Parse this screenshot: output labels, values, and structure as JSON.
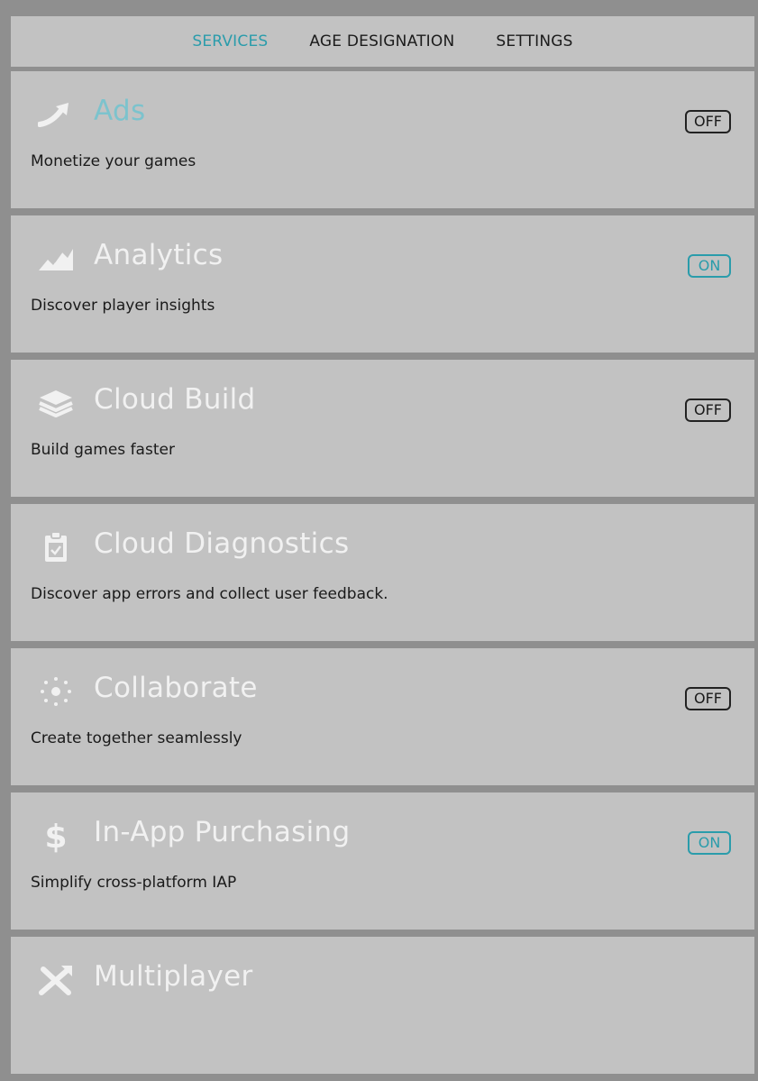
{
  "tabs": {
    "services": "SERVICES",
    "age_designation": "AGE DESIGNATION",
    "settings": "SETTINGS"
  },
  "colors": {
    "accent": "#2a9cab",
    "title_inactive": "#f1f1f1",
    "card_bg": "#c2c2c2"
  },
  "services": [
    {
      "icon": "trending-arrow-icon",
      "title": "Ads",
      "description": "Monetize your games",
      "toggle": "OFF"
    },
    {
      "icon": "chart-area-icon",
      "title": "Analytics",
      "description": "Discover player insights",
      "toggle": "ON"
    },
    {
      "icon": "layers-icon",
      "title": "Cloud Build",
      "description": "Build games faster",
      "toggle": "OFF"
    },
    {
      "icon": "clipboard-check-icon",
      "title": "Cloud Diagnostics",
      "description": "Discover app errors and collect user feedback.",
      "toggle": ""
    },
    {
      "icon": "network-nodes-icon",
      "title": "Collaborate",
      "description": "Create together seamlessly",
      "toggle": "OFF"
    },
    {
      "icon": "dollar-icon",
      "title": "In-App Purchasing",
      "description": "Simplify cross-platform IAP",
      "toggle": "ON"
    },
    {
      "icon": "crossed-arrows-icon",
      "title": "Multiplayer",
      "description": "",
      "toggle": ""
    }
  ]
}
